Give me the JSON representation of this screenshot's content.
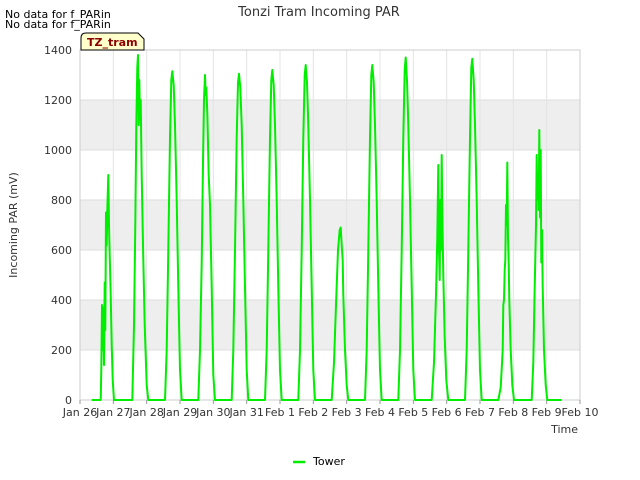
{
  "notices": [
    "No data for f_PARin",
    "No data for f_PARin"
  ],
  "site_badge": "TZ_tram",
  "colors": {
    "series": "#00ee00",
    "band": "#eeeeee",
    "badge_bg": "#ffffcc",
    "badge_text": "#8b0000"
  },
  "chart_data": {
    "type": "line",
    "title": "Tonzi Tram Incoming PAR",
    "xlabel": "Time",
    "ylabel": "Incoming PAR (mV)",
    "xlim": [
      0,
      15
    ],
    "ylim": [
      0,
      1400
    ],
    "yticks": [
      0,
      200,
      400,
      600,
      800,
      1000,
      1200,
      1400
    ],
    "xticks": [
      {
        "v": 0,
        "label": "Jan 26"
      },
      {
        "v": 1,
        "label": "Jan 27"
      },
      {
        "v": 2,
        "label": "Jan 28"
      },
      {
        "v": 3,
        "label": "Jan 29"
      },
      {
        "v": 4,
        "label": "Jan 30"
      },
      {
        "v": 5,
        "label": "Jan 31"
      },
      {
        "v": 6,
        "label": "Feb 1"
      },
      {
        "v": 7,
        "label": "Feb 2"
      },
      {
        "v": 8,
        "label": "Feb 3"
      },
      {
        "v": 9,
        "label": "Feb 4"
      },
      {
        "v": 10,
        "label": "Feb 5"
      },
      {
        "v": 11,
        "label": "Feb 6"
      },
      {
        "v": 12,
        "label": "Feb 7"
      },
      {
        "v": 13,
        "label": "Feb 8"
      },
      {
        "v": 14,
        "label": "Feb 9"
      },
      {
        "v": 15,
        "label": "Feb 10"
      }
    ],
    "grid": true,
    "legend_position": "bottom-center",
    "series": [
      {
        "name": "Tower",
        "x_start": 0.35,
        "x_end": 14.45,
        "days": [
          {
            "start": 0.62,
            "end": 1.02,
            "pts": [
              [
                0.62,
                0
              ],
              [
                0.64,
                120
              ],
              [
                0.66,
                380
              ],
              [
                0.68,
                200
              ],
              [
                0.7,
                370
              ],
              [
                0.72,
                140
              ],
              [
                0.74,
                470
              ],
              [
                0.76,
                280
              ],
              [
                0.78,
                750
              ],
              [
                0.8,
                620
              ],
              [
                0.82,
                760
              ],
              [
                0.85,
                900
              ],
              [
                0.87,
                700
              ],
              [
                0.89,
                580
              ],
              [
                0.92,
                420
              ],
              [
                0.95,
                220
              ],
              [
                0.98,
                80
              ],
              [
                1.02,
                0
              ]
            ]
          },
          {
            "start": 1.57,
            "end": 2.05,
            "pts": [
              [
                1.57,
                0
              ],
              [
                1.62,
                300
              ],
              [
                1.66,
                700
              ],
              [
                1.69,
                1100
              ],
              [
                1.72,
                1330
              ],
              [
                1.74,
                1380
              ],
              [
                1.76,
                1100
              ],
              [
                1.78,
                1280
              ],
              [
                1.8,
                1120
              ],
              [
                1.82,
                1200
              ],
              [
                1.85,
                900
              ],
              [
                1.89,
                620
              ],
              [
                1.94,
                300
              ],
              [
                2.0,
                60
              ],
              [
                2.05,
                0
              ]
            ]
          },
          {
            "start": 2.55,
            "end": 3.05,
            "pts": [
              [
                2.55,
                0
              ],
              [
                2.6,
                200
              ],
              [
                2.65,
                600
              ],
              [
                2.7,
                1050
              ],
              [
                2.74,
                1280
              ],
              [
                2.77,
                1315
              ],
              [
                2.81,
                1260
              ],
              [
                2.85,
                1100
              ],
              [
                2.9,
                800
              ],
              [
                2.95,
                450
              ],
              [
                3.0,
                120
              ],
              [
                3.05,
                0
              ]
            ]
          },
          {
            "start": 3.55,
            "end": 4.05,
            "pts": [
              [
                3.55,
                0
              ],
              [
                3.6,
                200
              ],
              [
                3.65,
                550
              ],
              [
                3.69,
                950
              ],
              [
                3.72,
                1200
              ],
              [
                3.75,
                1300
              ],
              [
                3.77,
                1220
              ],
              [
                3.79,
                1250
              ],
              [
                3.82,
                1150
              ],
              [
                3.86,
                900
              ],
              [
                3.9,
                780
              ],
              [
                3.95,
                450
              ],
              [
                4.0,
                100
              ],
              [
                4.05,
                0
              ]
            ]
          },
          {
            "start": 4.55,
            "end": 5.05,
            "pts": [
              [
                4.55,
                0
              ],
              [
                4.6,
                200
              ],
              [
                4.65,
                600
              ],
              [
                4.7,
                1050
              ],
              [
                4.74,
                1270
              ],
              [
                4.77,
                1305
              ],
              [
                4.81,
                1250
              ],
              [
                4.85,
                1100
              ],
              [
                4.9,
                800
              ],
              [
                4.95,
                450
              ],
              [
                5.0,
                120
              ],
              [
                5.05,
                0
              ]
            ]
          },
          {
            "start": 5.55,
            "end": 6.05,
            "pts": [
              [
                5.55,
                0
              ],
              [
                5.6,
                200
              ],
              [
                5.65,
                600
              ],
              [
                5.7,
                1050
              ],
              [
                5.74,
                1280
              ],
              [
                5.77,
                1320
              ],
              [
                5.81,
                1260
              ],
              [
                5.85,
                1100
              ],
              [
                5.9,
                800
              ],
              [
                5.95,
                450
              ],
              [
                6.0,
                120
              ],
              [
                6.05,
                0
              ]
            ]
          },
          {
            "start": 6.55,
            "end": 7.05,
            "pts": [
              [
                6.55,
                0
              ],
              [
                6.6,
                200
              ],
              [
                6.65,
                600
              ],
              [
                6.7,
                1050
              ],
              [
                6.74,
                1300
              ],
              [
                6.77,
                1340
              ],
              [
                6.81,
                1270
              ],
              [
                6.85,
                1100
              ],
              [
                6.9,
                800
              ],
              [
                6.95,
                450
              ],
              [
                7.0,
                120
              ],
              [
                7.05,
                0
              ]
            ]
          },
          {
            "start": 7.55,
            "end": 8.05,
            "pts": [
              [
                7.55,
                0
              ],
              [
                7.62,
                150
              ],
              [
                7.68,
                380
              ],
              [
                7.74,
                600
              ],
              [
                7.79,
                680
              ],
              [
                7.82,
                690
              ],
              [
                7.85,
                620
              ],
              [
                7.88,
                560
              ],
              [
                7.9,
                420
              ],
              [
                7.92,
                330
              ],
              [
                7.95,
                200
              ],
              [
                8.0,
                60
              ],
              [
                8.05,
                0
              ]
            ]
          },
          {
            "start": 8.55,
            "end": 9.05,
            "pts": [
              [
                8.55,
                0
              ],
              [
                8.6,
                200
              ],
              [
                8.65,
                600
              ],
              [
                8.7,
                1050
              ],
              [
                8.74,
                1300
              ],
              [
                8.77,
                1340
              ],
              [
                8.81,
                1270
              ],
              [
                8.85,
                1100
              ],
              [
                8.9,
                800
              ],
              [
                8.95,
                450
              ],
              [
                9.0,
                120
              ],
              [
                9.05,
                0
              ]
            ]
          },
          {
            "start": 9.55,
            "end": 10.05,
            "pts": [
              [
                9.55,
                0
              ],
              [
                9.6,
                200
              ],
              [
                9.65,
                600
              ],
              [
                9.7,
                1050
              ],
              [
                9.74,
                1320
              ],
              [
                9.77,
                1370
              ],
              [
                9.81,
                1280
              ],
              [
                9.85,
                1100
              ],
              [
                9.9,
                800
              ],
              [
                9.95,
                450
              ],
              [
                10.0,
                120
              ],
              [
                10.05,
                0
              ]
            ]
          },
          {
            "start": 10.55,
            "end": 11.05,
            "pts": [
              [
                10.55,
                0
              ],
              [
                10.62,
                150
              ],
              [
                10.68,
                420
              ],
              [
                10.72,
                650
              ],
              [
                10.75,
                940
              ],
              [
                10.77,
                600
              ],
              [
                10.79,
                480
              ],
              [
                10.81,
                800
              ],
              [
                10.83,
                600
              ],
              [
                10.85,
                980
              ],
              [
                10.87,
                750
              ],
              [
                10.9,
                500
              ],
              [
                10.94,
                250
              ],
              [
                10.99,
                80
              ],
              [
                11.05,
                0
              ]
            ]
          },
          {
            "start": 11.55,
            "end": 12.05,
            "pts": [
              [
                11.55,
                0
              ],
              [
                11.6,
                200
              ],
              [
                11.65,
                600
              ],
              [
                11.7,
                1050
              ],
              [
                11.74,
                1330
              ],
              [
                11.77,
                1365
              ],
              [
                11.81,
                1280
              ],
              [
                11.85,
                1100
              ],
              [
                11.9,
                800
              ],
              [
                11.95,
                450
              ],
              [
                12.0,
                120
              ],
              [
                12.05,
                0
              ]
            ]
          },
          {
            "start": 12.55,
            "end": 13.02,
            "pts": [
              [
                12.55,
                0
              ],
              [
                12.62,
                50
              ],
              [
                12.68,
                200
              ],
              [
                12.7,
                380
              ],
              [
                12.72,
                400
              ],
              [
                12.74,
                520
              ],
              [
                12.76,
                560
              ],
              [
                12.78,
                780
              ],
              [
                12.8,
                700
              ],
              [
                12.82,
                950
              ],
              [
                12.84,
                650
              ],
              [
                12.86,
                550
              ],
              [
                12.88,
                400
              ],
              [
                12.92,
                200
              ],
              [
                12.97,
                60
              ],
              [
                13.02,
                0
              ]
            ]
          },
          {
            "start": 13.55,
            "end": 14.02,
            "pts": [
              [
                13.55,
                0
              ],
              [
                13.6,
                150
              ],
              [
                13.64,
                450
              ],
              [
                13.68,
                700
              ],
              [
                13.7,
                980
              ],
              [
                13.72,
                800
              ],
              [
                13.74,
                880
              ],
              [
                13.76,
                760
              ],
              [
                13.78,
                1080
              ],
              [
                13.8,
                730
              ],
              [
                13.82,
                1000
              ],
              [
                13.84,
                550
              ],
              [
                13.86,
                680
              ],
              [
                13.88,
                450
              ],
              [
                13.92,
                200
              ],
              [
                13.97,
                60
              ],
              [
                14.02,
                0
              ]
            ]
          }
        ]
      }
    ]
  }
}
